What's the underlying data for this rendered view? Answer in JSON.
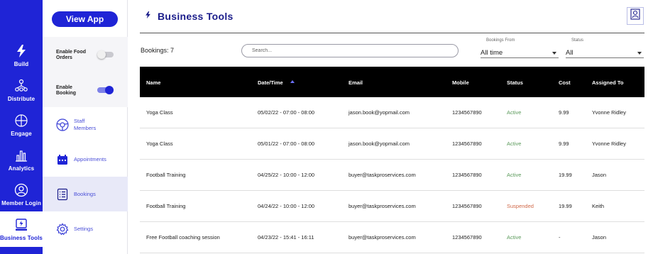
{
  "rail": [
    {
      "label": "Build",
      "icon": "lightning-icon",
      "active": false
    },
    {
      "label": "Distribute",
      "icon": "distribute-icon",
      "active": false
    },
    {
      "label": "Engage",
      "icon": "engage-icon",
      "active": false
    },
    {
      "label": "Analytics",
      "icon": "analytics-icon",
      "active": false
    },
    {
      "label": "Member Login",
      "icon": "member-login-icon",
      "active": false
    },
    {
      "label": "Business Tools",
      "icon": "business-tools-icon",
      "active": true
    }
  ],
  "sidebar": {
    "view_app_label": "View App",
    "toggles": [
      {
        "label_line1": "Enable Food",
        "label_line2": "Orders",
        "on": false
      },
      {
        "label_line1": "Enable",
        "label_line2": "Booking",
        "on": true
      }
    ],
    "items": [
      {
        "label_line1": "Staff",
        "label_line2": "Members",
        "icon": "staff-members-icon",
        "active": false
      },
      {
        "label_line1": "Appointments",
        "label_line2": "",
        "icon": "appointments-icon",
        "active": false
      },
      {
        "label_line1": "Bookings",
        "label_line2": "",
        "icon": "bookings-icon",
        "active": true
      },
      {
        "label_line1": "Settings",
        "label_line2": "",
        "icon": "settings-icon",
        "active": false
      }
    ]
  },
  "header": {
    "title": "Business Tools",
    "title_icon": "lightning-icon",
    "profile_icon": "profile-icon"
  },
  "toolbar": {
    "count_label": "Bookings: 7",
    "search_placeholder": "Search...",
    "bookings_from": {
      "caption": "Bookings From",
      "value": "All time"
    },
    "status": {
      "caption": "Status",
      "value": "All"
    }
  },
  "table": {
    "columns": [
      "Name",
      "Date/Time",
      "Email",
      "Mobile",
      "Status",
      "Cost",
      "Assigned To"
    ],
    "sorted_column": "Date/Time",
    "rows": [
      {
        "name": "Yoga Class",
        "datetime": "05/02/22 - 07:00 - 08:00",
        "email": "jason.book@yopmail.com",
        "mobile": "1234567890",
        "status": "Active",
        "cost": "9.99",
        "assigned": "Yvonne Ridley"
      },
      {
        "name": "Yoga Class",
        "datetime": "05/01/22 - 07:00 - 08:00",
        "email": "jason.book@yopmail.com",
        "mobile": "1234567890",
        "status": "Active",
        "cost": "9.99",
        "assigned": "Yvonne Ridley"
      },
      {
        "name": "Football Training",
        "datetime": "04/25/22 - 10:00 - 12:00",
        "email": "buyer@taskproservices.com",
        "mobile": "1234567890",
        "status": "Active",
        "cost": "19.99",
        "assigned": "Jason"
      },
      {
        "name": "Football Training",
        "datetime": "04/24/22 - 10:00 - 12:00",
        "email": "buyer@taskproservices.com",
        "mobile": "1234567890",
        "status": "Suspended",
        "cost": "19.99",
        "assigned": "Keith"
      },
      {
        "name": "Free Football coaching session",
        "datetime": "04/23/22 - 15:41 - 16:11",
        "email": "buyer@taskproservices.com",
        "mobile": "1234567890",
        "status": "Active",
        "cost": "-",
        "assigned": "Jason"
      }
    ]
  },
  "colors": {
    "brand": "#1f24d6",
    "title": "#1a1c8a",
    "active_status": "#5b9a5b",
    "suspended_status": "#d06a4a"
  }
}
